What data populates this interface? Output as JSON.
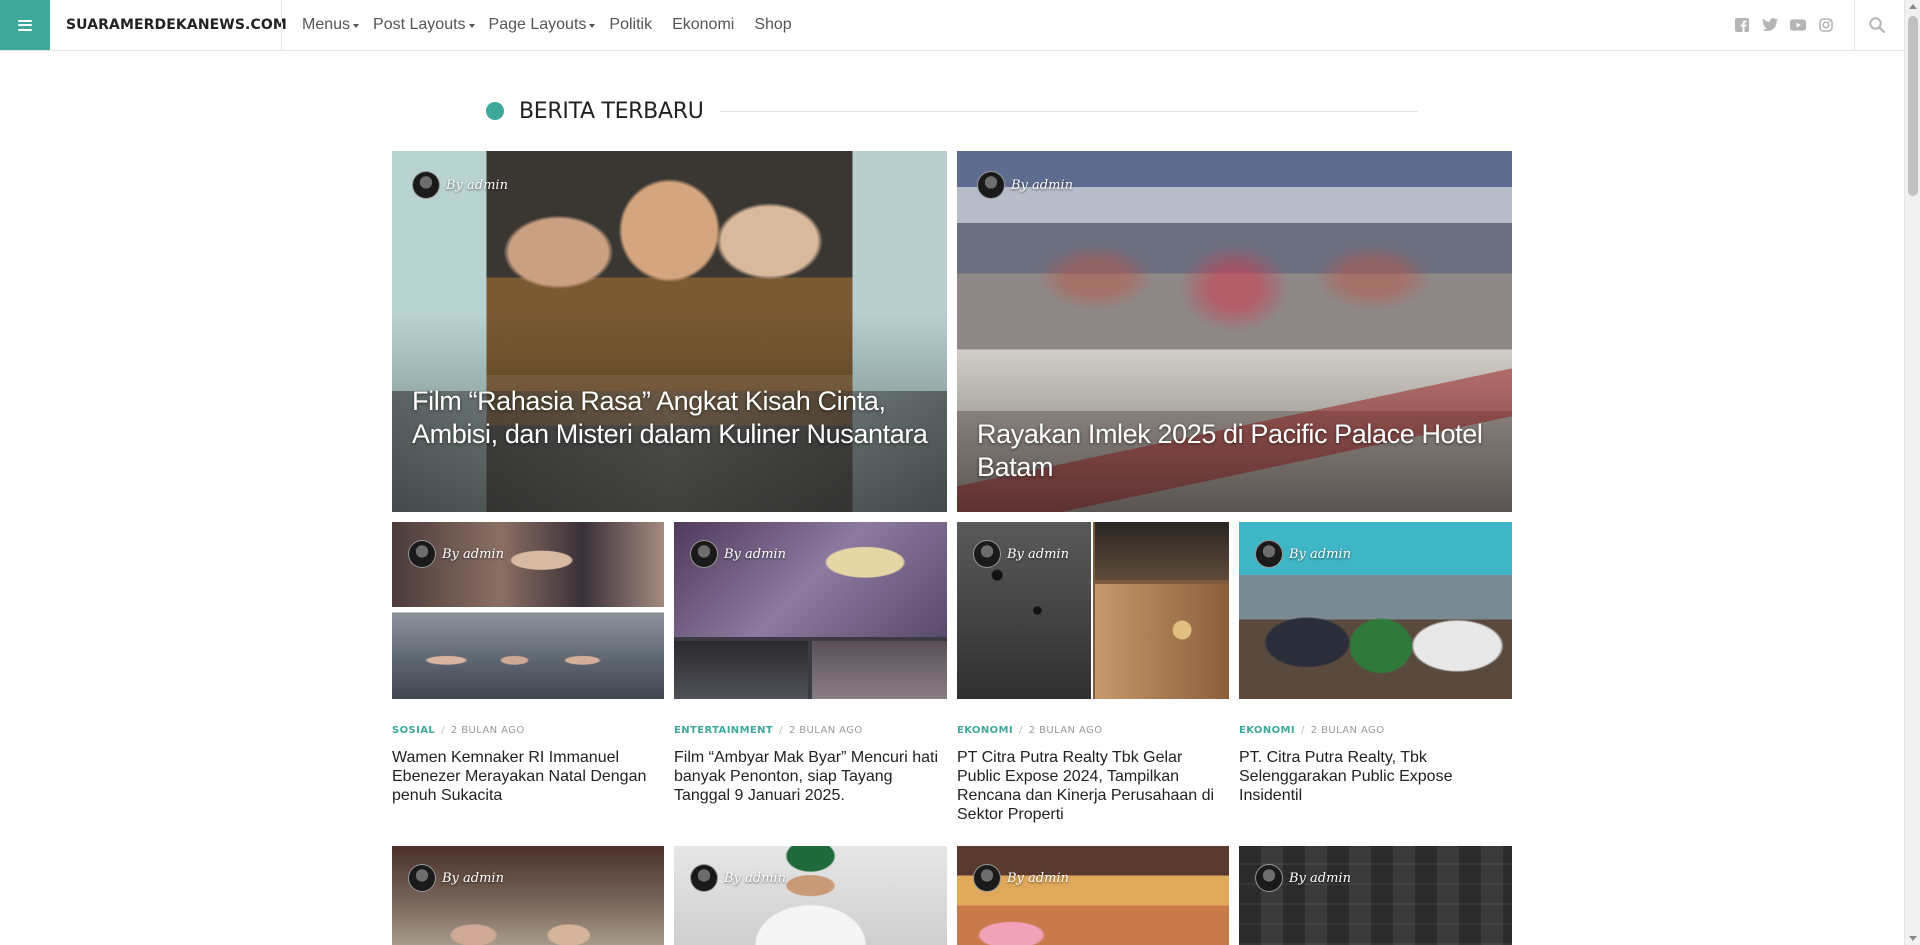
{
  "header": {
    "site_name": "SUARAMERDEKANEWS.COM",
    "nav": [
      {
        "label": "Menus"
      },
      {
        "label": "Post Layouts"
      },
      {
        "label": "Page Layouts"
      },
      {
        "label": "Politik"
      },
      {
        "label": "Ekonomi"
      },
      {
        "label": "Shop"
      }
    ],
    "social_icons": [
      "facebook-icon",
      "twitter-icon",
      "youtube-icon",
      "instagram-icon"
    ],
    "accent_color": "#3ea99a"
  },
  "section": {
    "title": "BERITA TERBARU"
  },
  "featured": [
    {
      "author": "By admin",
      "title": "Film “Rahasia Rasa” Angkat Kisah Cinta, Ambisi, dan Misteri dalam Kuliner Nusantara"
    },
    {
      "author": "By admin",
      "title": "Rayakan Imlek 2025 di Pacific Palace Hotel Batam"
    }
  ],
  "grid": [
    {
      "author": "By admin",
      "category": "SOSIAL",
      "ago": "2 BULAN AGO",
      "title": "Wamen Kemnaker RI Immanuel Ebenezer Merayakan Natal Dengan penuh Sukacita"
    },
    {
      "author": "By admin",
      "category": "ENTERTAINMENT",
      "ago": "2 BULAN AGO",
      "title": "Film “Ambyar Mak Byar” Mencuri hati banyak Penonton, siap Tayang Tanggal 9 Januari 2025."
    },
    {
      "author": "By admin",
      "category": "EKONOMI",
      "ago": "2 BULAN AGO",
      "title": "PT Citra Putra Realty Tbk Gelar Public Expose 2024, Tampilkan Rencana dan Kinerja Perusahaan di Sektor Properti"
    },
    {
      "author": "By admin",
      "category": "EKONOMI",
      "ago": "2 BULAN AGO",
      "title": "PT. Citra Putra Realty, Tbk Selenggarakan Public Expose Insidentil"
    }
  ],
  "grid_row2": [
    {
      "author": "By admin"
    },
    {
      "author": "By admin"
    },
    {
      "author": "By admin"
    },
    {
      "author": "By admin"
    }
  ],
  "meta_separator": "/"
}
